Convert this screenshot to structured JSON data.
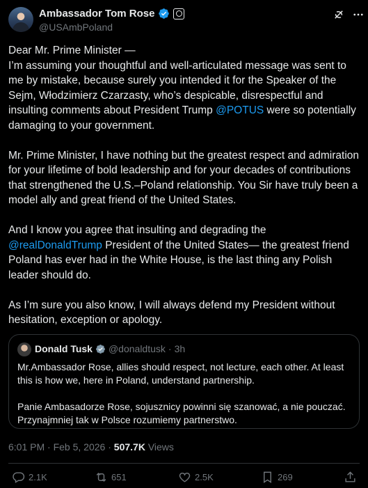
{
  "author": {
    "name": "Ambassador Tom Rose",
    "handle": "@USAmbPoland"
  },
  "post": {
    "greeting": "Dear Mr. Prime Minister —",
    "p1_before": "I’m assuming your thoughtful and well-articulated message was sent to me by mistake, because surely you intended it for the Speaker of the Sejm, Włodzimierz Czarzasty, who’s despicable, disrespectful and insulting comments about President Trump ",
    "p1_mention": "@POTUS",
    "p1_after": "  were so potentially damaging to your government.",
    "p2": "Mr. Prime Minister, I have nothing but the greatest  respect and admiration for your lifetime of bold leadership and for your decades of contributions that  strengthened the U.S.–Poland relationship. You Sir have truly been a model ally and great friend of the United States.",
    "p3_before": "And I know you agree that insulting and degrading the ",
    "p3_mention": "@realDonaldTrump",
    "p3_after": " President of the United States— the greatest friend Poland has ever had in the White House, is the last thing any Polish leader should do.",
    "p4": "As I’m sure you also know, I will always defend my President without hesitation, exception or apology."
  },
  "quote": {
    "name": "Donald Tusk",
    "handle": "@donaldtusk",
    "separator": "·",
    "time": "3h",
    "p1": "Mr.Ambassador Rose, allies should respect, not lecture, each other. At least this is how we, here in Poland, understand partnership.",
    "p2": "Panie Ambasadorze Rose, sojusznicy powinni się szanować, a nie pouczać. Przynajmniej tak w Polsce rozumiemy partnerstwo."
  },
  "meta": {
    "time": "6:01 PM",
    "dot1": "·",
    "date": "Feb 5, 2026",
    "dot2": "·",
    "views_count": "507.7K",
    "views_label": "Views"
  },
  "actions": {
    "replies": "2.1K",
    "reposts": "651",
    "likes": "2.5K",
    "bookmarks": "269"
  },
  "colors": {
    "background": "#000000",
    "text": "#e7e9ea",
    "secondary": "#71767b",
    "link": "#1d9bf0",
    "verified": "#1d9bf0",
    "quote_verified": "#829aab",
    "border": "#2f3336"
  },
  "icons": [
    "verified-badge-icon",
    "government-badge-icon",
    "grok-icon",
    "more-icon",
    "reply-icon",
    "repost-icon",
    "like-icon",
    "bookmark-icon",
    "share-icon"
  ]
}
